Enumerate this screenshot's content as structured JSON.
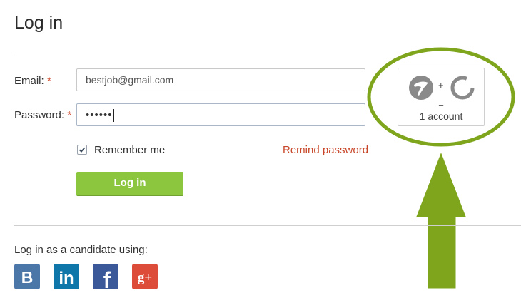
{
  "page": {
    "title": "Log in"
  },
  "form": {
    "email_label": "Email:",
    "email_value": "bestjob@gmail.com",
    "password_label": "Password:",
    "password_value": "••••••",
    "required_mark": "*",
    "remember_label": "Remember me",
    "remember_checked": true,
    "remind_label": "Remind password",
    "login_button": "Log in"
  },
  "promo": {
    "plus": "+",
    "equals": "=",
    "result": "1 account"
  },
  "social": {
    "title": "Log in as a candidate using:",
    "icons": [
      {
        "name": "vk-icon",
        "glyph": "B",
        "color": "#4a76a8"
      },
      {
        "name": "linkedin-icon",
        "glyph": "in",
        "color": "#0e76a8"
      },
      {
        "name": "facebook-icon",
        "glyph": "f",
        "color": "#3b5998"
      },
      {
        "name": "google-plus-icon",
        "glyph": "g+",
        "color": "#dd4b39"
      }
    ]
  },
  "colors": {
    "accent_green": "#8cc63f",
    "highlight_green": "#7ea51c",
    "required_red": "#d04a2e"
  }
}
